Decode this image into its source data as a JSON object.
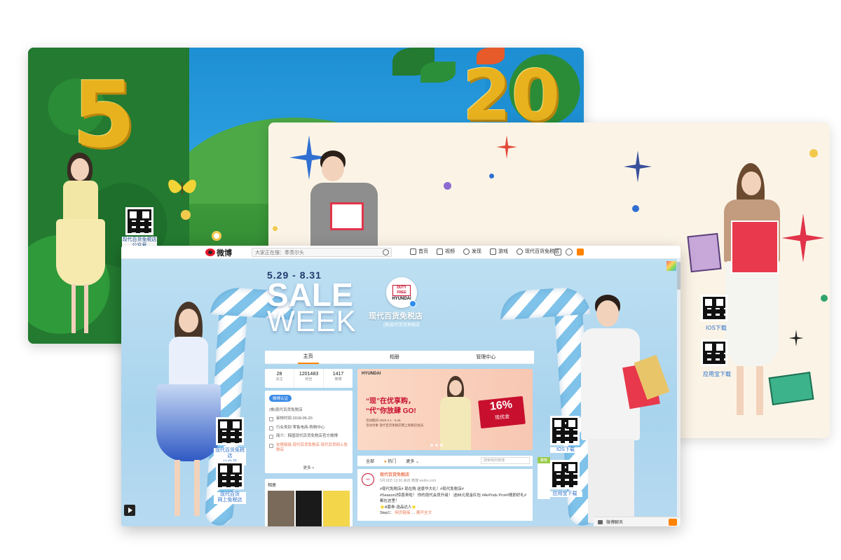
{
  "jungle_card": {
    "numbers": {
      "left": "5",
      "right": "20"
    },
    "qr_caption": "现代百货免税店\n公众号"
  },
  "cream_card": {
    "qr_ios_caption": "IOS下载",
    "qr_app_caption": "应用宝下载"
  },
  "weibo": {
    "logo": "微博",
    "search_placeholder": "大家正在搜：季羡尔头",
    "nav": [
      {
        "label": "首页",
        "icon": "home-icon"
      },
      {
        "label": "视频",
        "icon": "video-icon"
      },
      {
        "label": "发现",
        "icon": "compass-icon"
      },
      {
        "label": "游戏",
        "icon": "game-icon"
      },
      {
        "label": "现代百货免税店",
        "icon": "user-icon"
      }
    ],
    "message_badge": "",
    "promo": {
      "date": "5.29 - 8.31",
      "sale": "SALE",
      "week": "WEEK"
    },
    "profile": {
      "avatar_top": "DUTY FREE",
      "avatar_brand": "HYUNDAI",
      "name": "现代百货免税店",
      "subtitle": "(株)现代百货免税店"
    },
    "tabs": [
      {
        "label": "主页",
        "active": true
      },
      {
        "label": "相册",
        "active": false
      },
      {
        "label": "管理中心",
        "active": false
      }
    ],
    "stats": [
      {
        "value": "28",
        "label": "关注"
      },
      {
        "value": "1201483",
        "label": "粉丝"
      },
      {
        "value": "1417",
        "label": "微博"
      }
    ],
    "info": {
      "verified_tag": "微博认证",
      "company": "(株)现代百货免税店",
      "lines": [
        "审核时间 2018-05-20",
        "行业类别 零售电商-购物中心",
        "简介：韩国现代百货免税店官方微博",
        "友情链接 现代百货免税店 现代百货网上免税店"
      ],
      "more": "更多 >"
    },
    "album_title": "相册",
    "banner": {
      "brand": "HYUNDAI",
      "slogan_line1": "“现”在优享购，",
      "slogan_line2": "“代”你放肆 GO!",
      "period_label": "活动期间",
      "period_value": "2020.4.1 - 5.26",
      "target_label": "活动对象",
      "target_value": "现代百货免税店网上免税店会员",
      "percent": "16%",
      "coupon": "现优金"
    },
    "feed": {
      "tab_all": "全部",
      "tab_hot": "热门",
      "tab_more": "更多",
      "search_placeholder": "搜索我的微博"
    },
    "post": {
      "author": "现代百货免税店",
      "meta": "5月18日 13:30 来自 微博 weibo.com",
      "body_line1": "#现代免税店# 现在购 送豪华大礼！#现代免税店#",
      "body_line2": "#Season2惊喜来啦！ 你的现代会员升级！ 送88元现金红包 #AirPods Pro##随即好礼# 都在这里！",
      "body_line3": "⭐A套券·选品达人⭐",
      "body_line4": "Step1：",
      "link": "网页链接",
      "expand": "展开全文"
    },
    "side_mini_header": "推荐",
    "left_qr_caption": "现代百货免税店\n公众号",
    "left_qr2_caption": "现代百货\n网上免税店",
    "right_qr_caption": "IOS下载",
    "right_qr2_caption": "应用宝下载",
    "chat": "微博聊天"
  },
  "colors": {
    "weibo_orange": "#ff8200",
    "hyundai_red": "#c8102e",
    "link_orange": "#eb7350"
  }
}
